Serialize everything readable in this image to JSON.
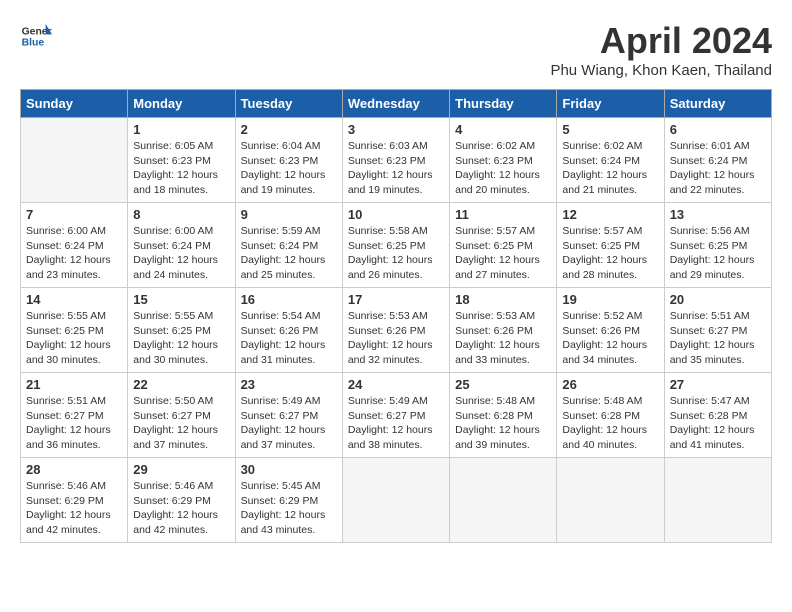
{
  "header": {
    "logo_line1": "General",
    "logo_line2": "Blue",
    "month_title": "April 2024",
    "location": "Phu Wiang, Khon Kaen, Thailand"
  },
  "days_of_week": [
    "Sunday",
    "Monday",
    "Tuesday",
    "Wednesday",
    "Thursday",
    "Friday",
    "Saturday"
  ],
  "weeks": [
    [
      {
        "day": "",
        "empty": true
      },
      {
        "day": "1",
        "sunrise": "6:05 AM",
        "sunset": "6:23 PM",
        "daylight": "12 hours and 18 minutes."
      },
      {
        "day": "2",
        "sunrise": "6:04 AM",
        "sunset": "6:23 PM",
        "daylight": "12 hours and 19 minutes."
      },
      {
        "day": "3",
        "sunrise": "6:03 AM",
        "sunset": "6:23 PM",
        "daylight": "12 hours and 19 minutes."
      },
      {
        "day": "4",
        "sunrise": "6:02 AM",
        "sunset": "6:23 PM",
        "daylight": "12 hours and 20 minutes."
      },
      {
        "day": "5",
        "sunrise": "6:02 AM",
        "sunset": "6:24 PM",
        "daylight": "12 hours and 21 minutes."
      },
      {
        "day": "6",
        "sunrise": "6:01 AM",
        "sunset": "6:24 PM",
        "daylight": "12 hours and 22 minutes."
      }
    ],
    [
      {
        "day": "7",
        "sunrise": "6:00 AM",
        "sunset": "6:24 PM",
        "daylight": "12 hours and 23 minutes."
      },
      {
        "day": "8",
        "sunrise": "6:00 AM",
        "sunset": "6:24 PM",
        "daylight": "12 hours and 24 minutes."
      },
      {
        "day": "9",
        "sunrise": "5:59 AM",
        "sunset": "6:24 PM",
        "daylight": "12 hours and 25 minutes."
      },
      {
        "day": "10",
        "sunrise": "5:58 AM",
        "sunset": "6:25 PM",
        "daylight": "12 hours and 26 minutes."
      },
      {
        "day": "11",
        "sunrise": "5:57 AM",
        "sunset": "6:25 PM",
        "daylight": "12 hours and 27 minutes."
      },
      {
        "day": "12",
        "sunrise": "5:57 AM",
        "sunset": "6:25 PM",
        "daylight": "12 hours and 28 minutes."
      },
      {
        "day": "13",
        "sunrise": "5:56 AM",
        "sunset": "6:25 PM",
        "daylight": "12 hours and 29 minutes."
      }
    ],
    [
      {
        "day": "14",
        "sunrise": "5:55 AM",
        "sunset": "6:25 PM",
        "daylight": "12 hours and 30 minutes."
      },
      {
        "day": "15",
        "sunrise": "5:55 AM",
        "sunset": "6:25 PM",
        "daylight": "12 hours and 30 minutes."
      },
      {
        "day": "16",
        "sunrise": "5:54 AM",
        "sunset": "6:26 PM",
        "daylight": "12 hours and 31 minutes."
      },
      {
        "day": "17",
        "sunrise": "5:53 AM",
        "sunset": "6:26 PM",
        "daylight": "12 hours and 32 minutes."
      },
      {
        "day": "18",
        "sunrise": "5:53 AM",
        "sunset": "6:26 PM",
        "daylight": "12 hours and 33 minutes."
      },
      {
        "day": "19",
        "sunrise": "5:52 AM",
        "sunset": "6:26 PM",
        "daylight": "12 hours and 34 minutes."
      },
      {
        "day": "20",
        "sunrise": "5:51 AM",
        "sunset": "6:27 PM",
        "daylight": "12 hours and 35 minutes."
      }
    ],
    [
      {
        "day": "21",
        "sunrise": "5:51 AM",
        "sunset": "6:27 PM",
        "daylight": "12 hours and 36 minutes."
      },
      {
        "day": "22",
        "sunrise": "5:50 AM",
        "sunset": "6:27 PM",
        "daylight": "12 hours and 37 minutes."
      },
      {
        "day": "23",
        "sunrise": "5:49 AM",
        "sunset": "6:27 PM",
        "daylight": "12 hours and 37 minutes."
      },
      {
        "day": "24",
        "sunrise": "5:49 AM",
        "sunset": "6:27 PM",
        "daylight": "12 hours and 38 minutes."
      },
      {
        "day": "25",
        "sunrise": "5:48 AM",
        "sunset": "6:28 PM",
        "daylight": "12 hours and 39 minutes."
      },
      {
        "day": "26",
        "sunrise": "5:48 AM",
        "sunset": "6:28 PM",
        "daylight": "12 hours and 40 minutes."
      },
      {
        "day": "27",
        "sunrise": "5:47 AM",
        "sunset": "6:28 PM",
        "daylight": "12 hours and 41 minutes."
      }
    ],
    [
      {
        "day": "28",
        "sunrise": "5:46 AM",
        "sunset": "6:29 PM",
        "daylight": "12 hours and 42 minutes."
      },
      {
        "day": "29",
        "sunrise": "5:46 AM",
        "sunset": "6:29 PM",
        "daylight": "12 hours and 42 minutes."
      },
      {
        "day": "30",
        "sunrise": "5:45 AM",
        "sunset": "6:29 PM",
        "daylight": "12 hours and 43 minutes."
      },
      {
        "day": "",
        "empty": true
      },
      {
        "day": "",
        "empty": true
      },
      {
        "day": "",
        "empty": true
      },
      {
        "day": "",
        "empty": true
      }
    ]
  ],
  "labels": {
    "sunrise_prefix": "Sunrise: ",
    "sunset_prefix": "Sunset: ",
    "daylight_prefix": "Daylight: "
  }
}
